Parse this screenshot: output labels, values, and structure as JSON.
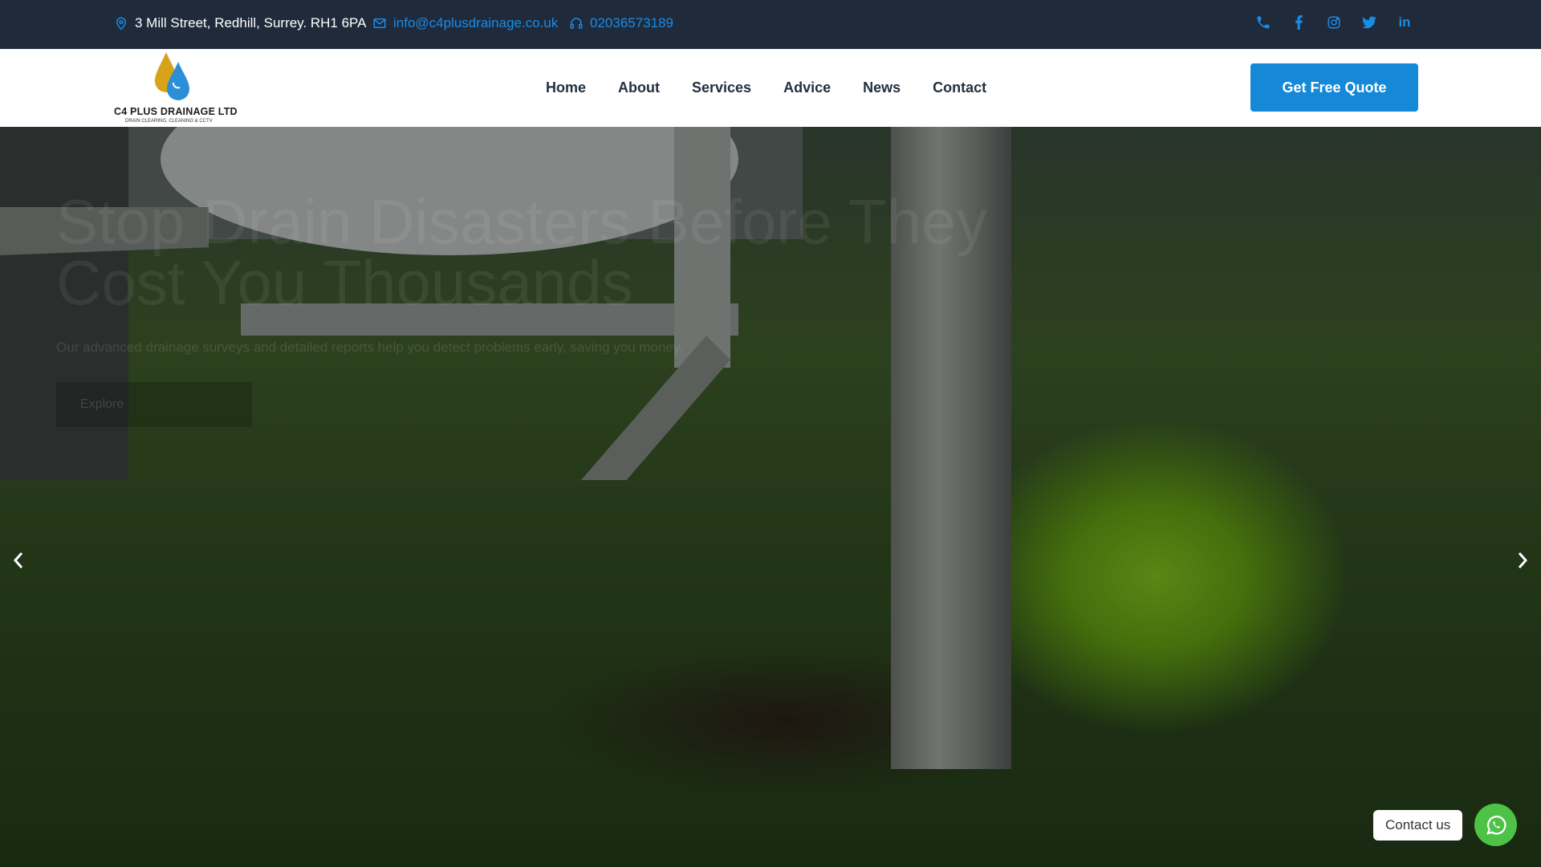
{
  "topbar": {
    "address": "3 Mill Street, Redhill, Surrey. RH1 6PA",
    "email": "info@c4plusdrainage.co.uk",
    "phone": "02036573189",
    "icons": {
      "address": "map-pin-icon",
      "email": "envelope-icon",
      "phone": "headphones-icon"
    },
    "socials": [
      "phone-icon",
      "facebook-icon",
      "instagram-icon",
      "twitter-icon",
      "linkedin-icon"
    ]
  },
  "logo": {
    "name": "C4 PLUS DRAINAGE LTD",
    "tagline": "DRAIN CLEARING, CLEANING & CCTV"
  },
  "nav": {
    "items": [
      "Home",
      "About",
      "Services",
      "Advice",
      "News",
      "Contact"
    ]
  },
  "header": {
    "cta": "Get Free Quote"
  },
  "hero": {
    "title": "Stop Drain Disasters Before They Cost You Thousands",
    "subtitle": "Our advanced drainage surveys and detailed reports help you detect problems early, saving you money.",
    "button": "Explore"
  },
  "widget": {
    "contact_label": "Contact us"
  },
  "colors": {
    "topbar_bg": "#1f2b3b",
    "accent": "#1588d8",
    "whatsapp": "#4dc247"
  }
}
